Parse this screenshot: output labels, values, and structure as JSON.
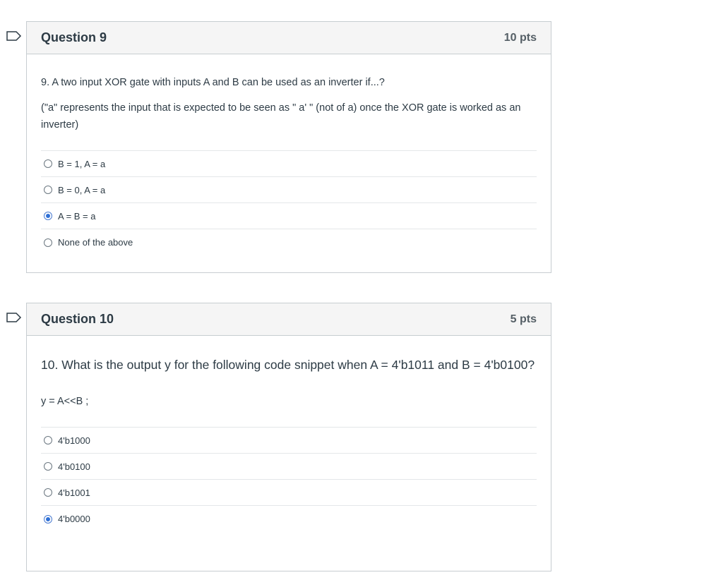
{
  "questions": [
    {
      "title": "Question 9",
      "points": "10 pts",
      "text_line1": "9. A two input XOR gate with inputs A and B can be used as an inverter if...?",
      "text_line2": "(\"a\" represents the input that is expected to be seen as \"  a'  \" (not of a)  once the XOR gate is worked as an inverter)",
      "answers": [
        {
          "label": "B = 1, A = a",
          "selected": false
        },
        {
          "label": "B = 0, A = a",
          "selected": false
        },
        {
          "label": "A = B = a",
          "selected": true
        },
        {
          "label": "None of the above",
          "selected": false
        }
      ]
    },
    {
      "title": "Question 10",
      "points": "5 pts",
      "text_line1": "10. What is the output y for the following code snippet when A = 4'b1011 and B = 4'b0100?",
      "code": "y = A<<B ;",
      "answers": [
        {
          "label": "4'b1000",
          "selected": false
        },
        {
          "label": "4'b0100",
          "selected": false
        },
        {
          "label": "4'b1001",
          "selected": false
        },
        {
          "label": "4'b0000",
          "selected": true
        }
      ]
    }
  ],
  "colors": {
    "border": "#c7cdd1",
    "header_bg": "#f5f5f5",
    "selected_radio": "#2d6fd6"
  },
  "icons": {
    "flag": "flag-question-icon"
  }
}
